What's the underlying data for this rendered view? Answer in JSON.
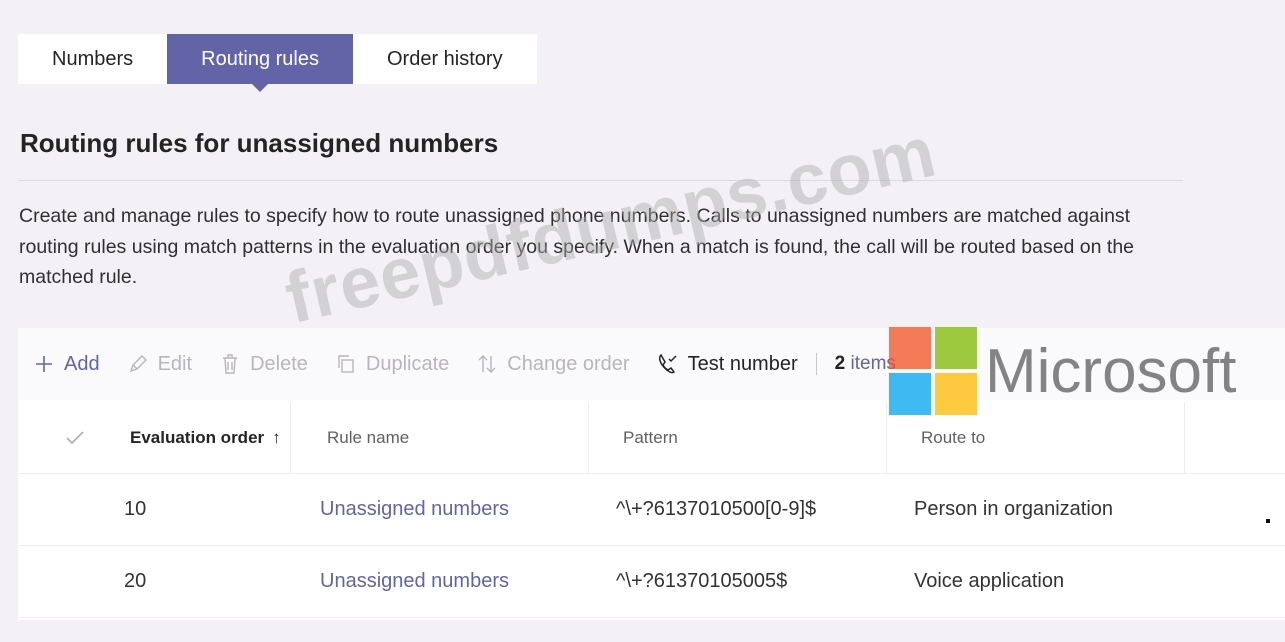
{
  "tabs": [
    {
      "label": "Numbers",
      "active": false
    },
    {
      "label": "Routing rules",
      "active": true
    },
    {
      "label": "Order history",
      "active": false
    }
  ],
  "page": {
    "title": "Routing rules for unassigned numbers",
    "description": "Create and manage rules to specify how to route unassigned phone numbers. Calls to unassigned numbers are matched against routing rules using match patterns in the evaluation order you specify. When a match is found, the call will be routed based on the matched rule."
  },
  "toolbar": {
    "add": "Add",
    "edit": "Edit",
    "delete": "Delete",
    "duplicate": "Duplicate",
    "change_order": "Change order",
    "test_number": "Test number",
    "count_num": "2",
    "count_word": "items"
  },
  "table": {
    "columns": [
      "Evaluation order",
      "Rule name",
      "Pattern",
      "Route to"
    ],
    "sort_indicator": "↑",
    "rows": [
      {
        "order": "10",
        "rule_name": "Unassigned numbers",
        "pattern": "^\\+?6137010500[0-9]$",
        "route_to": "Person in organization"
      },
      {
        "order": "20",
        "rule_name": "Unassigned numbers",
        "pattern": "^\\+?61370105005$",
        "route_to": "Voice application"
      }
    ]
  },
  "overlays": {
    "watermark": "freepdfdumps.com",
    "logo_text": "Microsoft"
  },
  "colors": {
    "accent": "#6264a7",
    "background": "#f3f1f5"
  }
}
